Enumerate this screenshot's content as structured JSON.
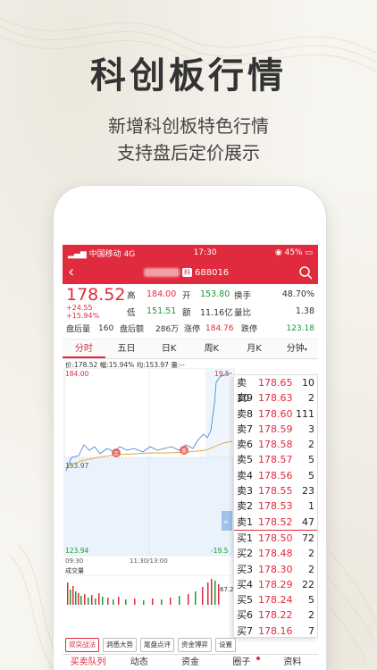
{
  "headline": "科创板行情",
  "subtitle_line1": "新增科创板特色行情",
  "subtitle_line2": "支持盘后定价展示",
  "status": {
    "carrier": "中国移动",
    "network": "4G",
    "time": "17:30",
    "battery": "45%"
  },
  "nav": {
    "code": "688016",
    "badge": "科"
  },
  "quote": {
    "price": "178.52",
    "change": "+24.55",
    "change_pct": "+15.94%",
    "high_label": "高",
    "high": "184.00",
    "open_label": "开",
    "open": "153.80",
    "turnover_label": "换手",
    "turnover": "48.70%",
    "low_label": "低",
    "low": "151.51",
    "amount_label": "额",
    "amount": "11.16亿",
    "ratio_label": "量比",
    "ratio": "1.38",
    "after_vol_label": "盘后量",
    "after_vol": "160",
    "after_amt_label": "盘后额",
    "after_amt": "286万",
    "limit_up_label": "涨停",
    "limit_up": "184.76",
    "limit_down_label": "跌停",
    "limit_down": "123.18"
  },
  "tabs": [
    "分时",
    "五日",
    "日K",
    "周K",
    "月K",
    "分钟"
  ],
  "chart_info": {
    "price": "价:178.52",
    "pct": "幅:15.94%",
    "avg": "均:153.97",
    "vol": "量:--"
  },
  "chart_labels": {
    "top": "184.00",
    "mid": "153.97",
    "bottom": "123.94",
    "pct_top": "19.5",
    "pct_bottom": "-19.5",
    "t_start": "09:30",
    "t_mid": "11:30/13:00",
    "t_end": "15:00",
    "vol_title": "成交量",
    "vol_val": "67.2",
    "buy_mark": "买",
    "sell_mark": "卖"
  },
  "order_book": {
    "asks": [
      {
        "label": "卖10",
        "price": "178.65",
        "vol": "10"
      },
      {
        "label": "卖9",
        "price": "178.63",
        "vol": "2"
      },
      {
        "label": "卖8",
        "price": "178.60",
        "vol": "111"
      },
      {
        "label": "卖7",
        "price": "178.59",
        "vol": "3"
      },
      {
        "label": "卖6",
        "price": "178.58",
        "vol": "2"
      },
      {
        "label": "卖5",
        "price": "178.57",
        "vol": "5"
      },
      {
        "label": "卖4",
        "price": "178.56",
        "vol": "5"
      },
      {
        "label": "卖3",
        "price": "178.55",
        "vol": "23"
      },
      {
        "label": "卖2",
        "price": "178.53",
        "vol": "1"
      },
      {
        "label": "卖1",
        "price": "178.52",
        "vol": "47"
      }
    ],
    "bids": [
      {
        "label": "买1",
        "price": "178.50",
        "vol": "72"
      },
      {
        "label": "买2",
        "price": "178.48",
        "vol": "2"
      },
      {
        "label": "买3",
        "price": "178.30",
        "vol": "2"
      },
      {
        "label": "买4",
        "price": "178.29",
        "vol": "22"
      },
      {
        "label": "买5",
        "price": "178.24",
        "vol": "5"
      },
      {
        "label": "买6",
        "price": "178.22",
        "vol": "2"
      },
      {
        "label": "买7",
        "price": "178.16",
        "vol": "7"
      }
    ]
  },
  "tool_buttons": [
    "双突战法",
    "洞悉大势",
    "尾盘点评",
    "资金博弈",
    "设置"
  ],
  "bottom_tabs": [
    "买卖队列",
    "动态",
    "资金",
    "圈子",
    "资料"
  ]
}
